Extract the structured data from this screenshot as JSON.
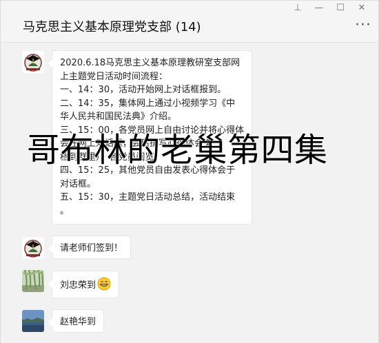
{
  "window": {
    "title": "马克思主义基本原理党支部 (14)",
    "controls": {
      "pin": "⊥",
      "minimize": "—",
      "maximize": "☐",
      "close": "✕"
    },
    "more": "···"
  },
  "messages": [
    {
      "sender_avatar": "university-logo",
      "lines": [
        "2020.6.18马克思主义基本原理教研室支部网",
        "上主题党日活动时间流程：",
        "一、14：30，活动开始网上对话框报到。",
        "二、14：35，集体网上通过小视频学习《中",
        "华人民共和国民法典》介绍。",
        "三、15：00，各党员网上自由讨论并将心得体",
        "会在网上对话框，会后撰写心得体会文",
        "档到群里），各党员阅览。",
        "四、15：25，其他党员自由发表心得体会于",
        "对话框。",
        "五、15：30，主题党日活动总结，活动结束",
        "。"
      ]
    },
    {
      "sender_avatar": "university-logo",
      "text": "请老师们签到！"
    },
    {
      "sender_avatar": "willow-tree-photo",
      "text": "刘忠荣到",
      "emoji": "grinning-face"
    },
    {
      "sender_avatar": "landscape-photo",
      "text": "赵艳华到"
    }
  ],
  "watermark": "哥布林的老巢第四集",
  "colors": {
    "window_bg": "#f2f2f2",
    "bubble_bg": "#ffffff",
    "title_text": "#111111"
  }
}
